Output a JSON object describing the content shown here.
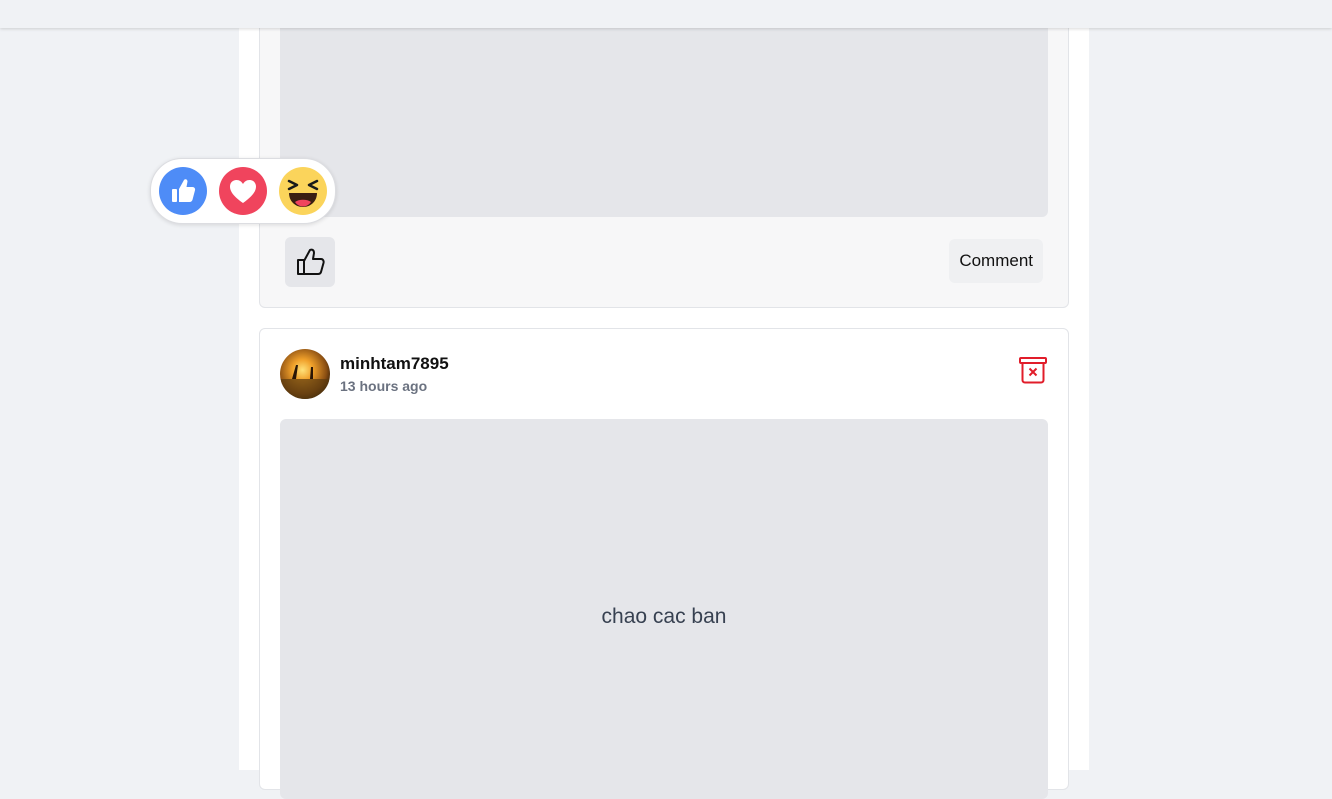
{
  "post_previous": {
    "like_icon": "thumbs-up-outline-icon",
    "comment_label": "Comment"
  },
  "reactions": [
    {
      "name": "like",
      "icon": "thumbs-up-icon",
      "color": "#4e8cf7"
    },
    {
      "name": "love",
      "icon": "heart-icon",
      "color": "#f0445d"
    },
    {
      "name": "haha",
      "icon": "laughing-face-icon",
      "color": "#fbd45b"
    }
  ],
  "post": {
    "author": "minhtam7895",
    "time": "13 hours ago",
    "text": "chao cac ban",
    "delete_icon": "trash-delete-icon",
    "delete_color": "#e11d2a"
  }
}
